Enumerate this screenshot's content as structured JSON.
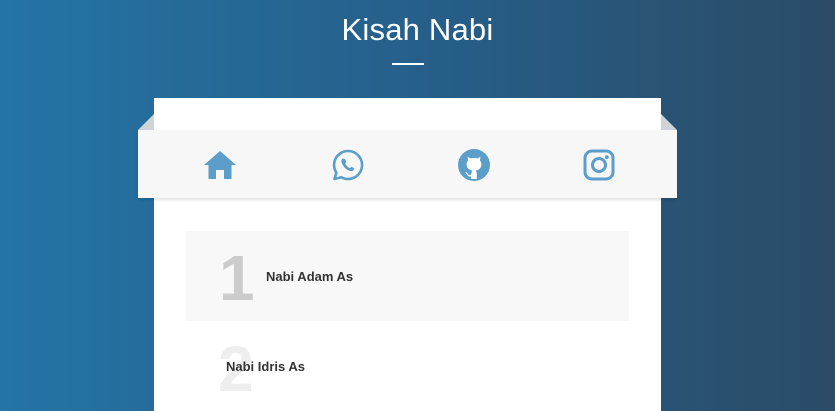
{
  "header": {
    "title": "Kisah Nabi"
  },
  "nav": {
    "items": [
      {
        "icon": "home-icon"
      },
      {
        "icon": "whatsapp-icon"
      },
      {
        "icon": "github-icon"
      },
      {
        "icon": "instagram-icon"
      }
    ],
    "icon_color": "#5b9ec9"
  },
  "list": {
    "items": [
      {
        "number": "1",
        "label": "Nabi Adam As"
      },
      {
        "number": "2",
        "label": "Nabi Idris As"
      }
    ]
  },
  "colors": {
    "background_left": "#2474a6",
    "background_right": "#2b4b66",
    "card": "#ffffff",
    "nav_bar": "#f7f7f7",
    "number_active": "#cccccc",
    "number_inactive": "#eeeeee"
  }
}
